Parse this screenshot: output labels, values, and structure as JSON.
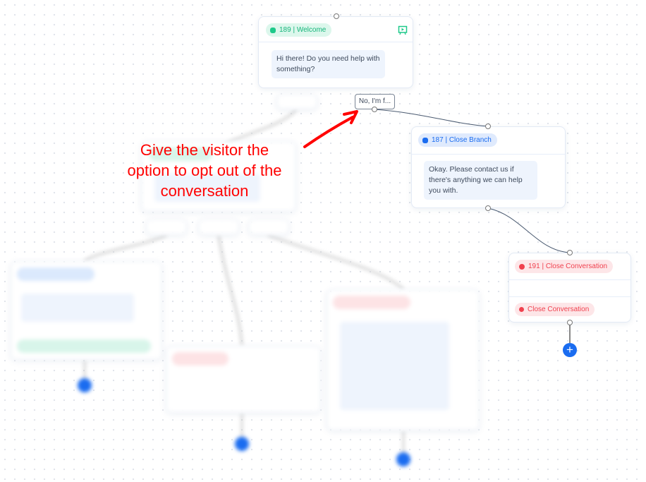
{
  "welcome_node": {
    "tag": "189 | Welcome",
    "message": "Hi there! Do you need help with something?",
    "icon": "present-icon",
    "color": "#1ec98a"
  },
  "option_button": {
    "label": "No, I'm f..."
  },
  "close_branch_node": {
    "tag": "187 | Close Branch",
    "message": "Okay. Please contact us if there's anything we can help you with.",
    "color": "#1a6cf0"
  },
  "close_conversation_node": {
    "tag": "191 | Close Conversation",
    "action": "Close Conversation",
    "color": "#f0414e"
  },
  "annotation": {
    "line1": "Give the visitor the",
    "line2": "option to opt out of the",
    "line3": "conversation",
    "color": "#ff0000"
  },
  "add_icon": "plus-icon"
}
